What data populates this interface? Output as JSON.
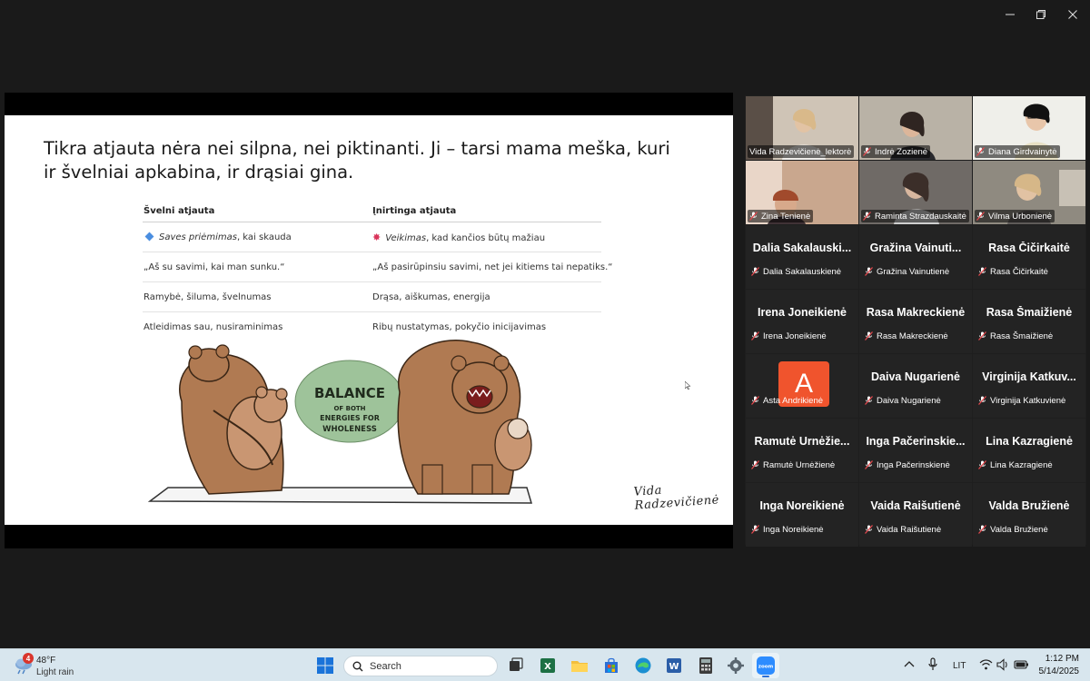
{
  "window": {
    "controls": [
      "minimize-icon",
      "restore-icon",
      "close-icon"
    ]
  },
  "slide": {
    "title": "Tikra atjauta nėra nei silpna, nei piktinanti. Ji – tarsi mama meška, kuri ir švelniai apkabina, ir drąsiai gina.",
    "headers": [
      "Švelni atjauta",
      "Įnirtinga atjauta"
    ],
    "rows": [
      {
        "left_em": "Saves priėmimas",
        "left_rest": ", kai skauda",
        "right_em": "Veikimas",
        "right_rest": ", kad kančios būtų mažiau"
      },
      {
        "left": "„Aš su savimi, kai man sunku.“",
        "right": "„Aš pasirūpinsiu savimi, net jei kitiems tai nepatiks.“"
      },
      {
        "left": "Ramybė, šiluma, švelnumas",
        "right": "Drąsa, aiškumas, energija"
      },
      {
        "left": "Atleidimas sau, nusiraminimas",
        "right": "Ribų nustatymas, pokyčio inicijavimas"
      }
    ],
    "illustration": {
      "line1": "BALANCE",
      "line2": "OF BOTH",
      "line3": "ENERGIES FOR",
      "line4": "WHOLENESS"
    },
    "signature": "Vida Radzevičienė"
  },
  "gallery": {
    "video_tiles": [
      {
        "name": "Vida Radzevičienė_lektorė",
        "muted": false,
        "active": true
      },
      {
        "name": "Indrė Zozienė",
        "muted": true
      },
      {
        "name": "Diana Girdvainytė",
        "muted": true
      },
      {
        "name": "Zina Tenienė",
        "muted": true
      },
      {
        "name": "Raminta Strazdauskaitė",
        "muted": true
      },
      {
        "name": "Vilma Urbonienė",
        "muted": true
      }
    ],
    "text_tiles": [
      {
        "big": "Dalia Sakalauski...",
        "name": "Dalia Sakalauskienė"
      },
      {
        "big": "Gražina Vainuti...",
        "name": "Gražina Vainutienė"
      },
      {
        "big": "Rasa Čičirkaitė",
        "name": "Rasa Čičirkaitė"
      },
      {
        "big": "Irena Joneikienė",
        "name": "Irena Joneikienė"
      },
      {
        "big": "Rasa Makreckienė",
        "name": "Rasa Makreckienė"
      },
      {
        "big": "Rasa Šmaižienė",
        "name": "Rasa Šmaižienė"
      },
      {
        "big": "",
        "name": "Asta Andrikienė",
        "avatar": "A",
        "avatar_color": "#f0542d"
      },
      {
        "big": "Daiva Nugarienė",
        "name": "Daiva Nugarienė"
      },
      {
        "big": "Virginija Katkuv...",
        "name": "Virginija Katkuvienė"
      },
      {
        "big": "Ramutė Urnėžie...",
        "name": "Ramutė Urnėžienė"
      },
      {
        "big": "Inga Pačerinskie...",
        "name": "Inga Pačerinskienė"
      },
      {
        "big": "Lina Kazragienė",
        "name": "Lina Kazragienė"
      },
      {
        "big": "Inga Noreikienė",
        "name": "Inga Noreikienė"
      },
      {
        "big": "Vaida Raišutienė",
        "name": "Vaida Raišutienė"
      },
      {
        "big": "Valda Bružienė",
        "name": "Valda Bružienė"
      }
    ]
  },
  "taskbar": {
    "weather": {
      "badge": "4",
      "temp": "48°F",
      "desc": "Light rain"
    },
    "search_placeholder": "Search",
    "apps": [
      "windows-start-icon",
      "task-view-icon",
      "excel-icon",
      "file-explorer-icon",
      "microsoft-store-icon",
      "edge-icon",
      "word-icon",
      "calculator-icon",
      "settings-icon",
      "zoom-icon"
    ],
    "tray": {
      "language": "LIT"
    },
    "clock": {
      "time": "1:12 PM",
      "date": "5/14/2025"
    }
  }
}
